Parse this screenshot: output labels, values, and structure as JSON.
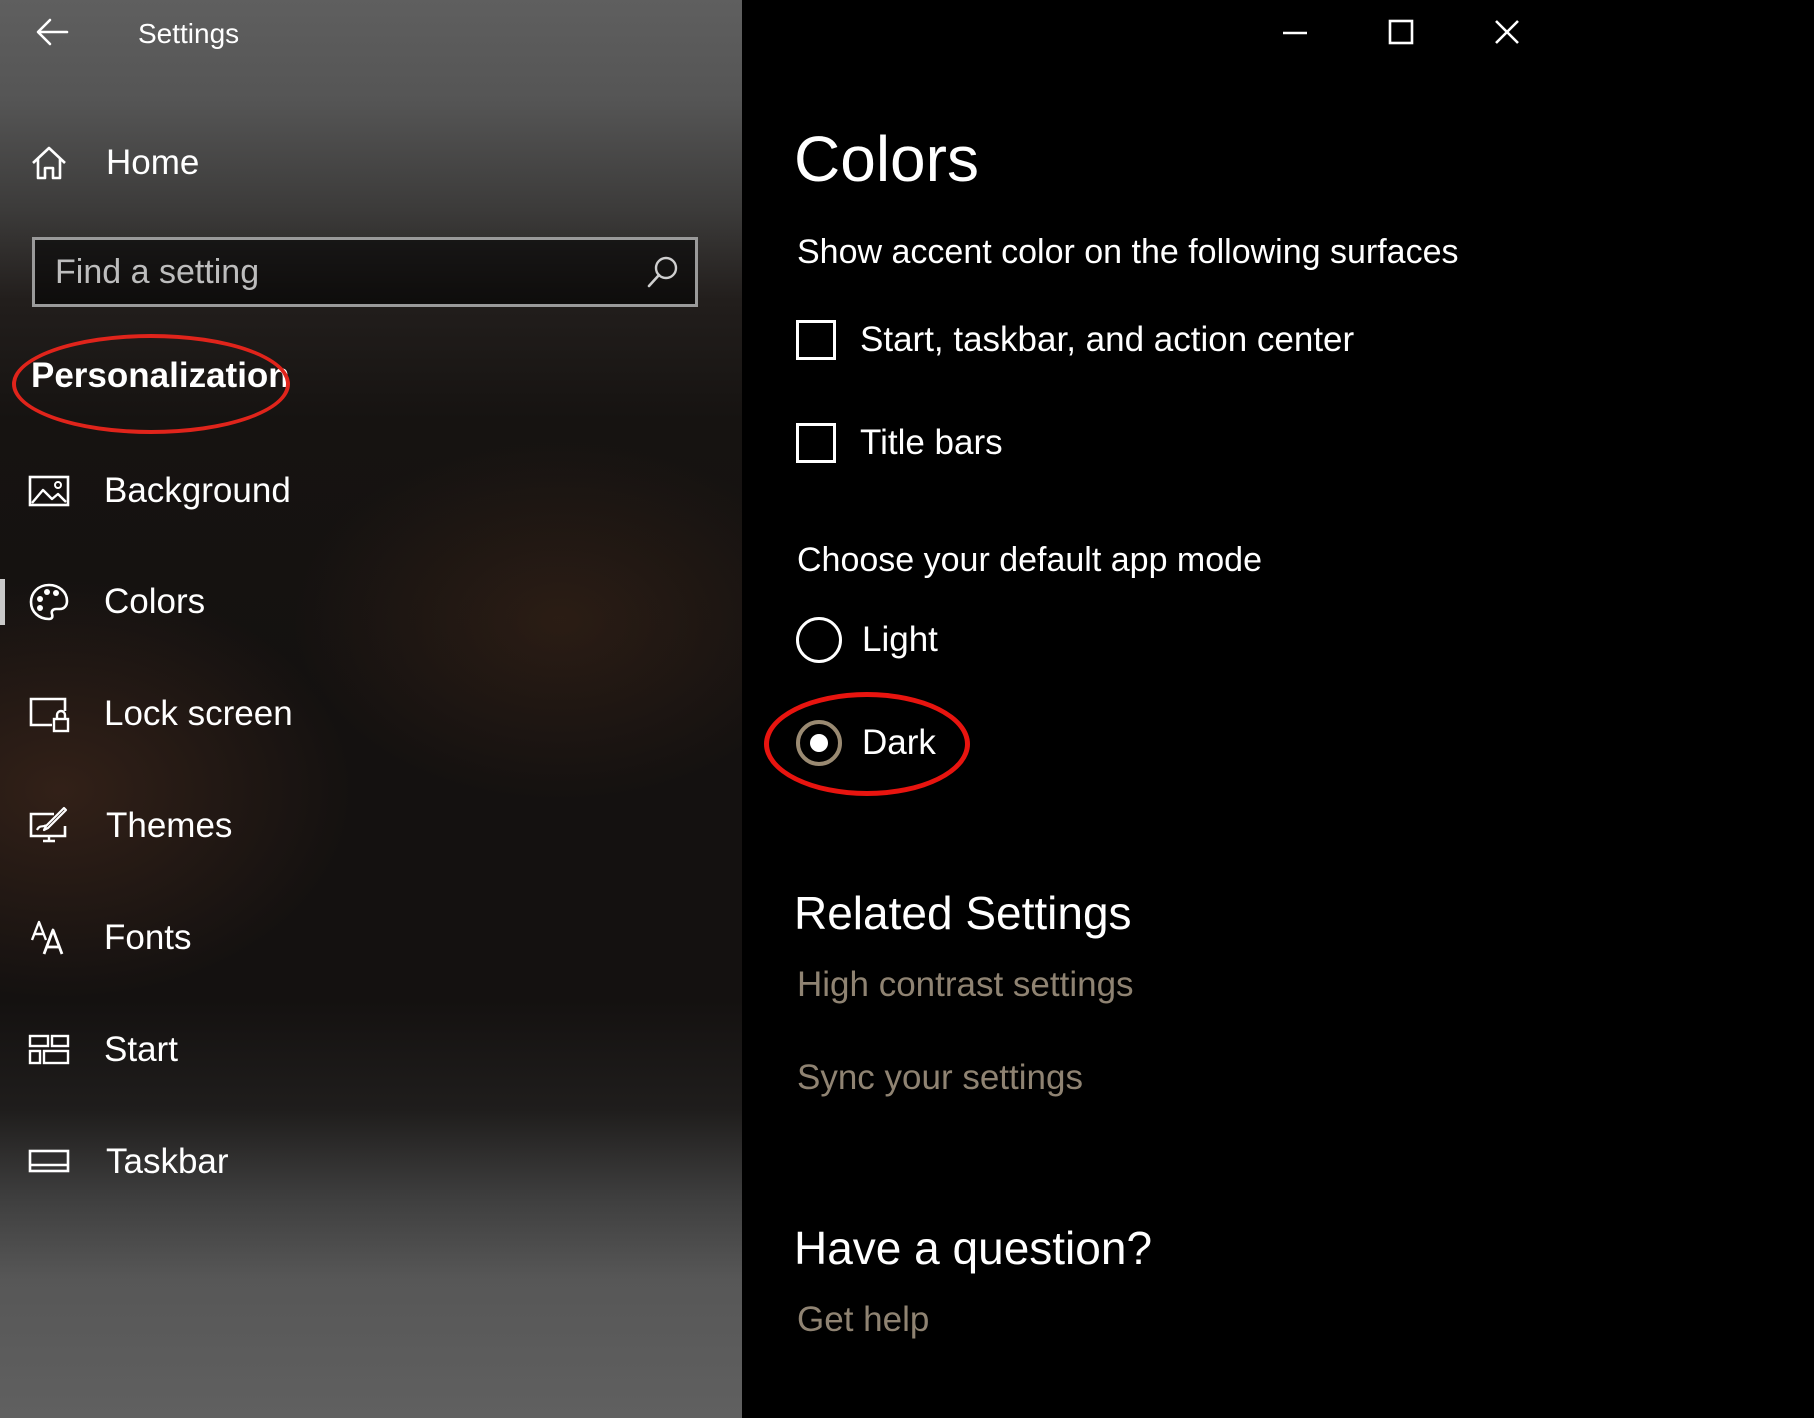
{
  "window": {
    "title": "Settings",
    "controls": [
      "minimize",
      "maximize",
      "close"
    ]
  },
  "sidebar": {
    "home_label": "Home",
    "search": {
      "placeholder": "Find a setting",
      "value": ""
    },
    "section_heading": "Personalization",
    "selected_item": "Colors",
    "items": [
      {
        "label": "Background",
        "icon": "picture-icon"
      },
      {
        "label": "Colors",
        "icon": "palette-icon"
      },
      {
        "label": "Lock screen",
        "icon": "lock-screen-icon"
      },
      {
        "label": "Themes",
        "icon": "themes-icon"
      },
      {
        "label": "Fonts",
        "icon": "fonts-icon"
      },
      {
        "label": "Start",
        "icon": "start-icon"
      },
      {
        "label": "Taskbar",
        "icon": "taskbar-icon"
      }
    ]
  },
  "main": {
    "title": "Colors",
    "accent_heading": "Show accent color on the following surfaces",
    "checkboxes": [
      {
        "label": "Start, taskbar, and action center",
        "checked": false
      },
      {
        "label": "Title bars",
        "checked": false
      }
    ],
    "app_mode_heading": "Choose your default app mode",
    "app_mode_options": [
      {
        "label": "Light",
        "selected": false
      },
      {
        "label": "Dark",
        "selected": true
      }
    ],
    "related_settings": {
      "title": "Related Settings",
      "links": [
        "High contrast settings",
        "Sync your settings"
      ]
    },
    "question": {
      "title": "Have a question?",
      "link": "Get help"
    }
  },
  "colors": {
    "highlight_ring": "#e0241b",
    "link_text": "#8f8372",
    "main_background": "#000000"
  }
}
